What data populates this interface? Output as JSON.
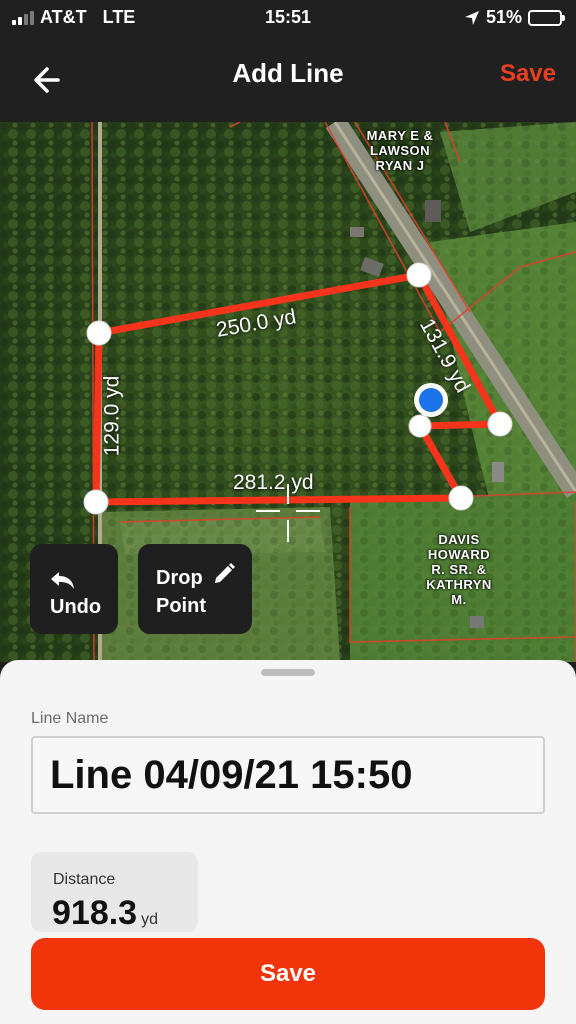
{
  "status_bar": {
    "carrier": "AT&T",
    "network": "LTE",
    "time": "15:51",
    "battery": "51%",
    "battery_level": 0.51,
    "signal_bars_filled": 2,
    "icons": [
      "signal-icon",
      "location-arrow-icon",
      "battery-icon"
    ]
  },
  "nav": {
    "back_icon": "arrow-left-icon",
    "title": "Add Line",
    "save_label": "Save"
  },
  "map": {
    "segments": [
      {
        "label": "250.0 yd"
      },
      {
        "label": "131.9 yd"
      },
      {
        "label": "129.0 yd"
      },
      {
        "label": "281.2 yd"
      }
    ],
    "parcel_owners": [
      {
        "lines": [
          "MARY E &",
          "LAWSON",
          "RYAN J"
        ]
      },
      {
        "lines": [
          "DAVIS",
          "HOWARD",
          "R. SR. &",
          "KATHRYN",
          "M."
        ]
      }
    ],
    "undo_label": "Undo",
    "undo_icon": "undo-icon",
    "drop_label_line1": "Drop",
    "drop_label_line2": "Point",
    "drop_icon": "pencil-icon",
    "line_color": "#f5341b",
    "location_color": "#1a73e8"
  },
  "sheet": {
    "line_name_label": "Line Name",
    "line_name_value": "Line 04/09/21 15:50",
    "distance_label": "Distance",
    "distance_value": "918.3",
    "distance_unit": "yd",
    "save_label": "Save",
    "accent_color": "#f1340a"
  }
}
